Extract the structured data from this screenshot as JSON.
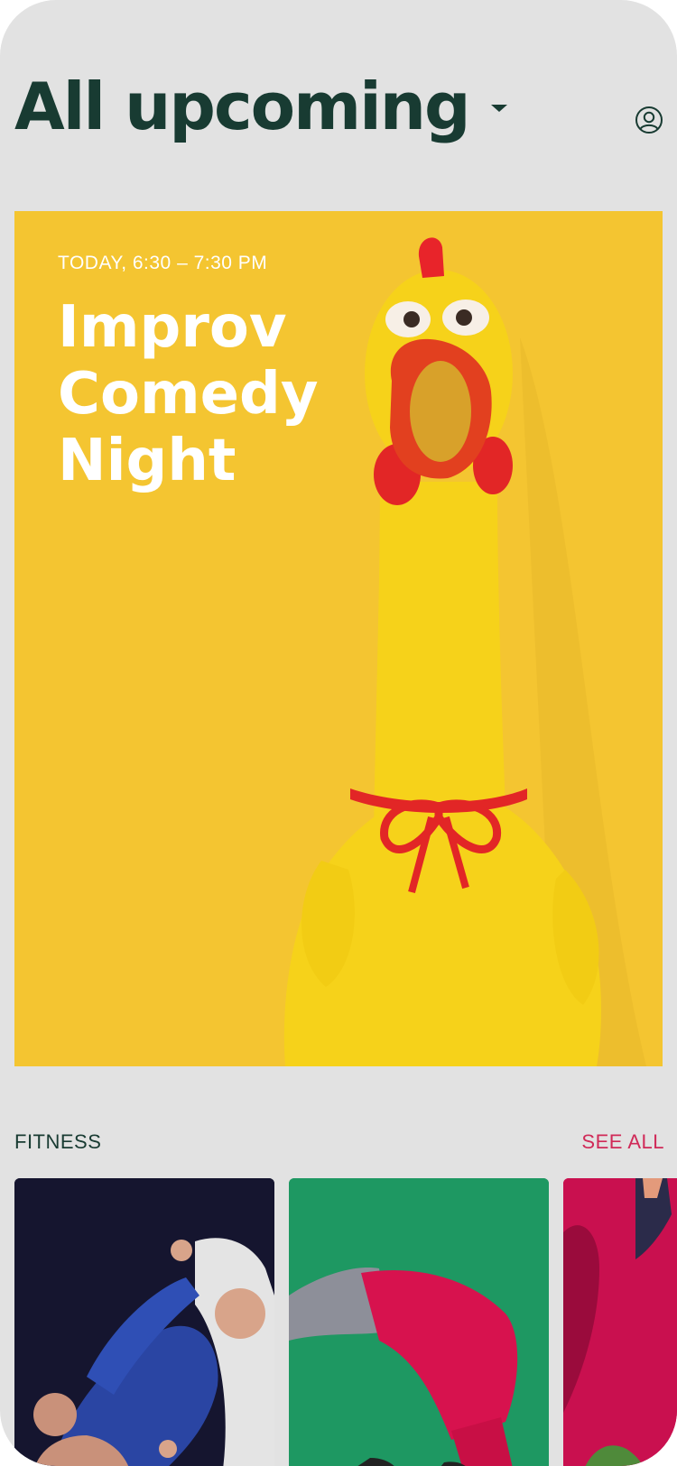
{
  "header": {
    "title": "All upcoming",
    "dropdown_icon": "caret-down-icon",
    "profile_icon": "user-circle-icon"
  },
  "featured": {
    "date_label": "TODAY,  6:30 – 7:30 PM",
    "title": "Improv Comedy Night",
    "background_color": "#f4c531",
    "image": "rubber-chicken-photo"
  },
  "section": {
    "label": "FITNESS",
    "see_all_label": "SEE ALL",
    "see_all_color": "#d02a58",
    "cards": [
      {
        "image": "jiu-jitsu-photo",
        "background_color": "#15152f"
      },
      {
        "image": "breakdance-photo",
        "background_color": "#1e9862"
      },
      {
        "image": "dance-photo",
        "background_color": "#c9104f"
      }
    ]
  },
  "colors": {
    "primary_text": "#183b32",
    "accent": "#d02a58",
    "page_background": "#e2e2e2"
  }
}
